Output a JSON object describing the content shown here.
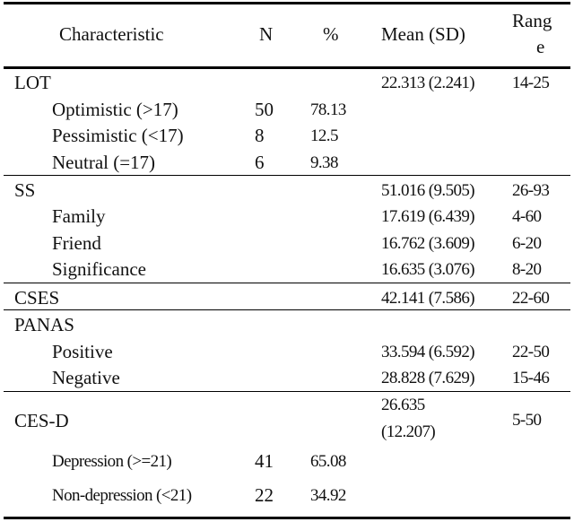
{
  "table": {
    "headers": {
      "characteristic": "Characteristic",
      "n": "N",
      "percent": "%",
      "mean_sd": "Mean (SD)",
      "range_line1": "Rang",
      "range_line2": "e"
    },
    "groups": [
      {
        "label": "LOT",
        "mean_sd": "22.313 (2.241)",
        "range": "14-25",
        "rows": [
          {
            "label": "Optimistic (>17)",
            "n": "50",
            "percent": "78.13",
            "mean_sd": "",
            "range": ""
          },
          {
            "label": "Pessimistic (<17)",
            "n": "8",
            "percent": "12.5",
            "mean_sd": "",
            "range": ""
          },
          {
            "label": "Neutral (=17)",
            "n": "6",
            "percent": "9.38",
            "mean_sd": "",
            "range": ""
          }
        ]
      },
      {
        "label": "SS",
        "mean_sd": "51.016 (9.505)",
        "range": "26-93",
        "rows": [
          {
            "label": "Family",
            "n": "",
            "percent": "",
            "mean_sd": "17.619 (6.439)",
            "range": "4-60"
          },
          {
            "label": "Friend",
            "n": "",
            "percent": "",
            "mean_sd": "16.762 (3.609)",
            "range": "6-20"
          },
          {
            "label": "Significance",
            "n": "",
            "percent": "",
            "mean_sd": "16.635 (3.076)",
            "range": "8-20"
          }
        ]
      },
      {
        "label": "CSES",
        "mean_sd": "42.141 (7.586)",
        "range": "22-60",
        "rows": []
      },
      {
        "label": "PANAS",
        "mean_sd": "",
        "range": "",
        "rows": [
          {
            "label": "Positive",
            "n": "",
            "percent": "",
            "mean_sd": "33.594 (6.592)",
            "range": "22-50"
          },
          {
            "label": "Negative",
            "n": "",
            "percent": "",
            "mean_sd": "28.828 (7.629)",
            "range": "15-46"
          }
        ]
      },
      {
        "label": "CES-D",
        "mean_sd_line1": "26.635",
        "mean_sd_line2": "(12.207)",
        "range": "5-50",
        "rows": [
          {
            "label": "Depression (>=21)",
            "n": "41",
            "percent": "65.08",
            "mean_sd": "",
            "range": ""
          },
          {
            "label": "Non-depression (<21)",
            "n": "22",
            "percent": "34.92",
            "mean_sd": "",
            "range": ""
          }
        ]
      }
    ]
  }
}
